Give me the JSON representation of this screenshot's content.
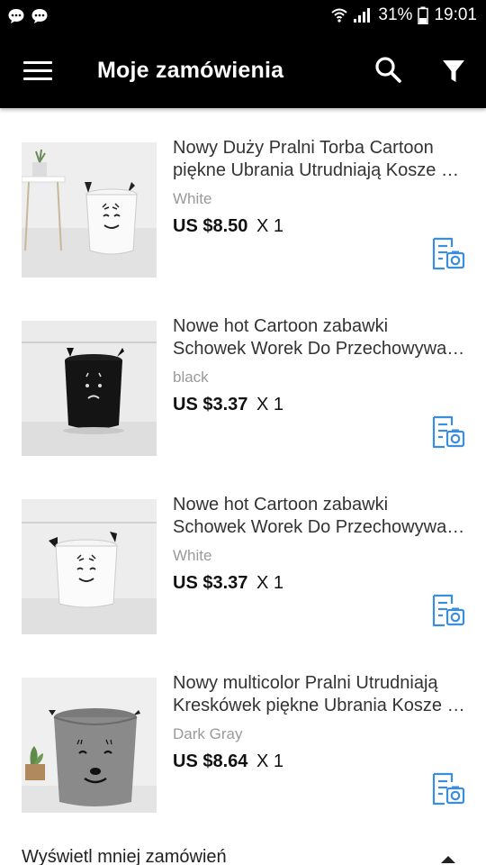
{
  "status_bar": {
    "battery_percent": "31%",
    "time": "19:01",
    "icons": [
      "chat-bubble-icon",
      "chat-bubble-icon",
      "wifi-icon",
      "signal-icon",
      "battery-icon"
    ]
  },
  "app_bar": {
    "title": "Moje zamówienia",
    "icons": [
      "menu-icon",
      "search-icon",
      "filter-icon"
    ]
  },
  "orders": [
    {
      "title_line1": "Nowy Duży Pralni Torba Cartoon",
      "title_line2": "piękne Ubrania Utrudniają Kosze Pranie",
      "variant": "White",
      "price": "US $8.50",
      "qty": "X 1",
      "image": "white-laundry-basket-smile"
    },
    {
      "title_line1": "Nowe hot Cartoon zabawki",
      "title_line2": "Schowek Worek Do Przechowywania",
      "variant": "black",
      "price": "US $3.37",
      "qty": "X 1",
      "image": "black-laundry-basket-sad"
    },
    {
      "title_line1": "Nowe hot Cartoon zabawki",
      "title_line2": "Schowek Worek Do Przechowywania",
      "variant": "White",
      "price": "US $3.37",
      "qty": "X 1",
      "image": "white-laundry-basket-smile"
    },
    {
      "title_line1": "Nowy multicolor Pralni Utrudniają",
      "title_line2": "Kreskówek piękne Ubrania Kosze Pranie",
      "variant": "Dark Gray",
      "price": "US $8.64",
      "qty": "X 1",
      "image": "gray-laundry-basket-bear"
    }
  ],
  "footer": {
    "label": "Wyświetl mniej zamówień"
  },
  "colors": {
    "app_bar": "#000000",
    "accent_icon": "#3b8ddd",
    "variant_text": "#9a9a9a"
  }
}
